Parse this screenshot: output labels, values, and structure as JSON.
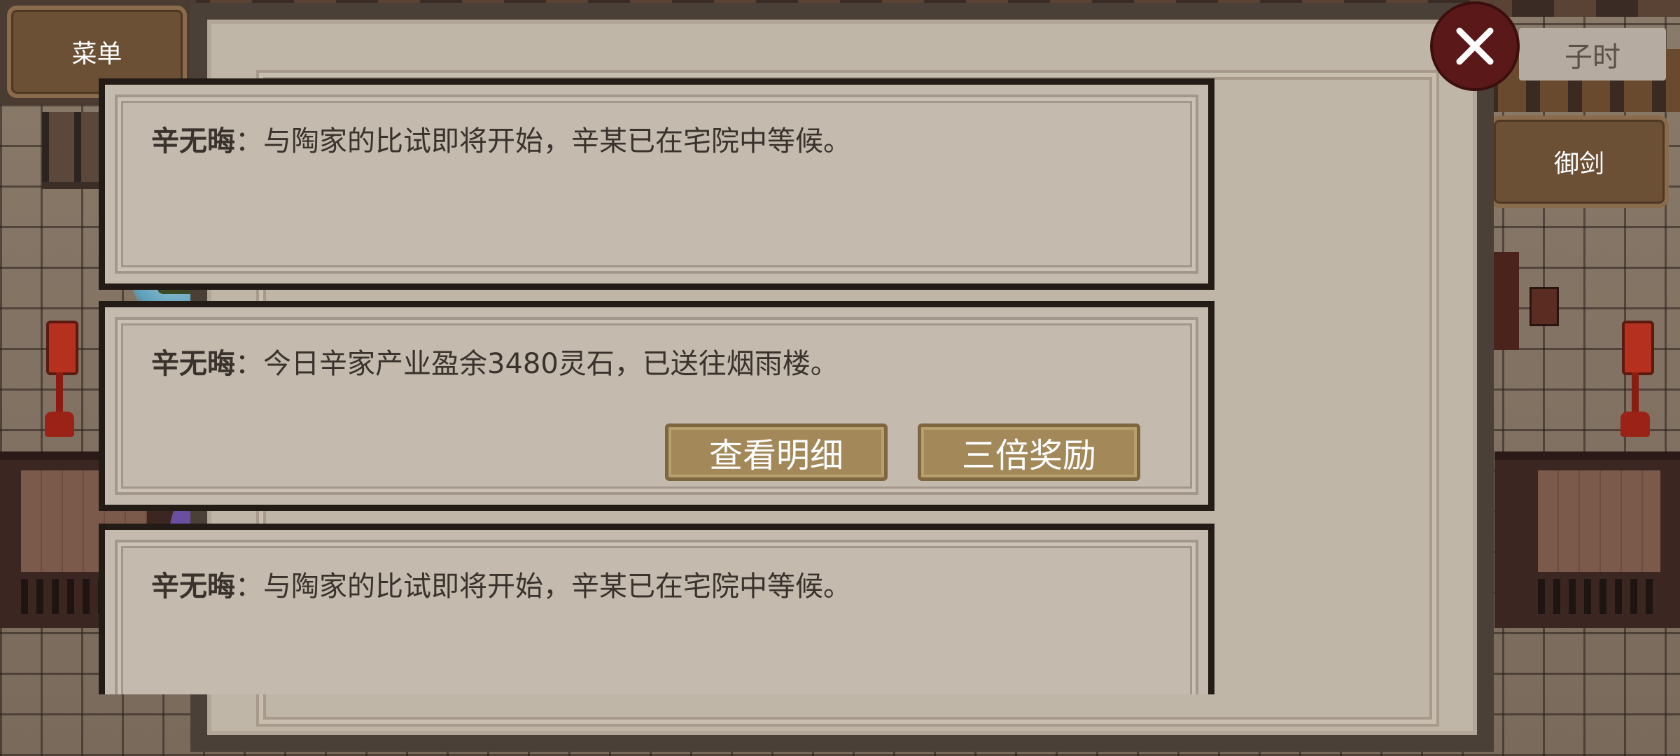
{
  "hud": {
    "menu_label": "菜单",
    "time_label": "子时",
    "sword_label": "御剑"
  },
  "messages": [
    {
      "speaker": "辛无晦",
      "separator": "：",
      "text": "与陶家的比试即将开始，辛某已在宅院中等候。"
    },
    {
      "speaker": "辛无晦",
      "separator": "：",
      "text": "今日辛家产业盈余3480灵石，已送往烟雨楼。",
      "buttons": [
        "查看明细",
        "三倍奖励"
      ]
    },
    {
      "speaker": "辛无晦",
      "separator": "：",
      "text": "与陶家的比试即将开始，辛某已在宅院中等候。"
    }
  ],
  "icons": {
    "close": "close-icon"
  },
  "colors": {
    "panel": "#c0b6a8",
    "card_border": "#231b16",
    "action_button": "#a3895a",
    "close_button": "#5b1818",
    "hud_button": "#6b5036"
  }
}
